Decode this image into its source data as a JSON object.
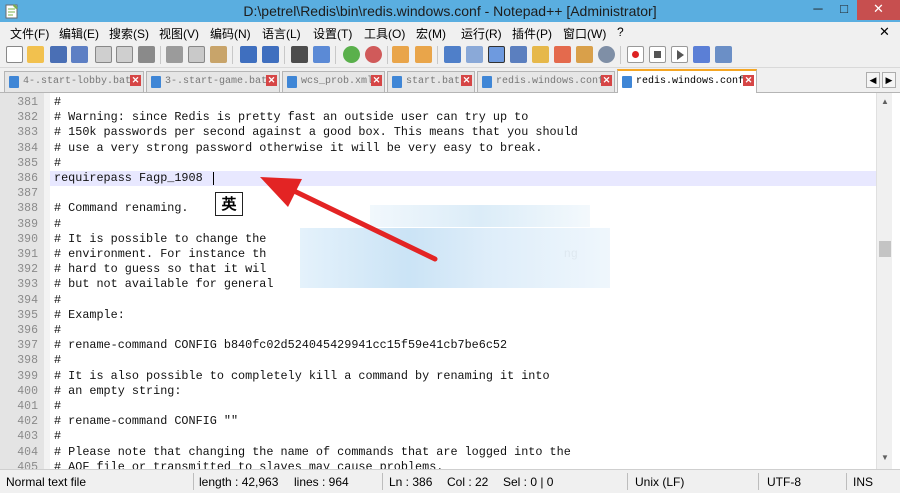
{
  "window": {
    "title": "D:\\petrel\\Redis\\bin\\redis.windows.conf - Notepad++ [Administrator]",
    "min": "─",
    "max": "□",
    "close": "✕"
  },
  "menu": [
    "文件(F)",
    "编辑(E)",
    "搜索(S)",
    "视图(V)",
    "编码(N)",
    "语言(L)",
    "设置(T)",
    "工具(O)",
    "宏(M)",
    "运行(R)",
    "插件(P)",
    "窗口(W)",
    "?"
  ],
  "menu_close": "✕",
  "tabs": [
    {
      "label": "4-.start-lobby.bat",
      "active": false
    },
    {
      "label": "3-.start-game.bat",
      "active": false
    },
    {
      "label": "wcs_prob.xml",
      "active": false
    },
    {
      "label": "start.bat",
      "active": false
    },
    {
      "label": "redis.windows.conf",
      "active": false
    },
    {
      "label": "redis.windows.conf",
      "active": true
    }
  ],
  "tab_close": "✕",
  "tab_nav": {
    "left": "◀",
    "right": "▶"
  },
  "lines": [
    {
      "num": "381",
      "text": "#"
    },
    {
      "num": "382",
      "text": "# Warning: since Redis is pretty fast an outside user can try up to"
    },
    {
      "num": "383",
      "text": "# 150k passwords per second against a good box. This means that you should"
    },
    {
      "num": "384",
      "text": "# use a very strong password otherwise it will be very easy to break."
    },
    {
      "num": "385",
      "text": "#"
    },
    {
      "num": "386",
      "text": "requirepass Fagp_1908"
    },
    {
      "num": "387",
      "text": ""
    },
    {
      "num": "388",
      "text": "# Command renaming."
    },
    {
      "num": "389",
      "text": "#"
    },
    {
      "num": "390",
      "text": "# It is possible to change the"
    },
    {
      "num": "391",
      "text": "# environment. For instance th                                          ng"
    },
    {
      "num": "392",
      "text": "# hard to guess so that it wil"
    },
    {
      "num": "393",
      "text": "# but not available for general"
    },
    {
      "num": "394",
      "text": "#"
    },
    {
      "num": "395",
      "text": "# Example:"
    },
    {
      "num": "396",
      "text": "#"
    },
    {
      "num": "397",
      "text": "# rename-command CONFIG b840fc02d524045429941cc15f59e41cb7be6c52"
    },
    {
      "num": "398",
      "text": "#"
    },
    {
      "num": "399",
      "text": "# It is also possible to completely kill a command by renaming it into"
    },
    {
      "num": "400",
      "text": "# an empty string:"
    },
    {
      "num": "401",
      "text": "#"
    },
    {
      "num": "402",
      "text": "# rename-command CONFIG \"\""
    },
    {
      "num": "403",
      "text": "#"
    },
    {
      "num": "404",
      "text": "# Please note that changing the name of commands that are logged into the"
    },
    {
      "num": "405",
      "text": "# AOF file or transmitted to slaves may cause problems."
    }
  ],
  "ime": "英",
  "colors": {
    "arrow": "#e32424",
    "titlebar": "#5aaee0",
    "current_line": "#e8e8ff",
    "active_tab_accent": "#f5a623"
  },
  "status": {
    "type": "Normal text file",
    "length": "length : 42,963",
    "lines": "lines : 964",
    "ln": "Ln : 386",
    "col": "Col : 22",
    "sel": "Sel : 0 | 0",
    "eol": "Unix (LF)",
    "encoding": "UTF-8",
    "mode": "INS"
  },
  "scroll": {
    "up": "▲",
    "down": "▼"
  }
}
